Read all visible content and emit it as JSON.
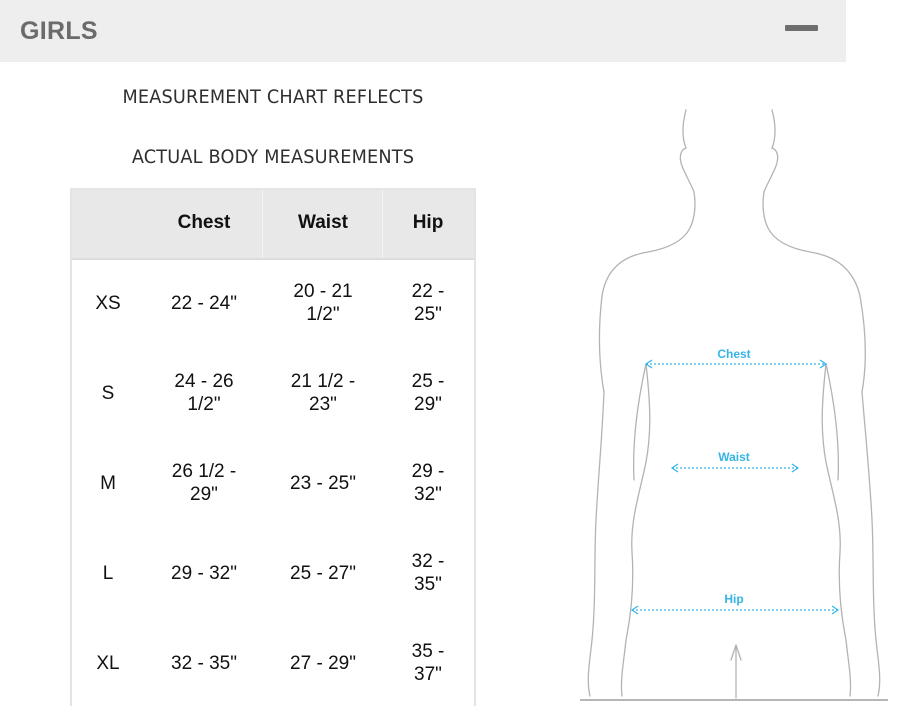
{
  "section": {
    "title": "GIRLS",
    "collapse_icon": "minus-icon"
  },
  "headings": {
    "line1": "MEASUREMENT CHART REFLECTS",
    "line2": "ACTUAL BODY MEASUREMENTS"
  },
  "table": {
    "columns": [
      "",
      "Chest",
      "Waist",
      "Hip"
    ],
    "rows": [
      {
        "size": "XS",
        "chest": "22 - 24\"",
        "waist": "20 - 21 1/2\"",
        "hip": "22 - 25\""
      },
      {
        "size": "S",
        "chest": "24 - 26 1/2\"",
        "waist": "21 1/2 - 23\"",
        "hip": "25 - 29\""
      },
      {
        "size": "M",
        "chest": "26 1/2 - 29\"",
        "waist": "23 - 25\"",
        "hip": "29 - 32\""
      },
      {
        "size": "L",
        "chest": "29 - 32\"",
        "waist": "25 - 27\"",
        "hip": "32 - 35\""
      },
      {
        "size": "XL",
        "chest": "32 - 35\"",
        "waist": "27 - 29\"",
        "hip": "35 - 37\""
      }
    ]
  },
  "figure": {
    "labels": {
      "chest": "Chest",
      "waist": "Waist",
      "hip": "Hip"
    },
    "colors": {
      "outline": "#b3b3b3",
      "measure": "#35b5e5"
    }
  }
}
